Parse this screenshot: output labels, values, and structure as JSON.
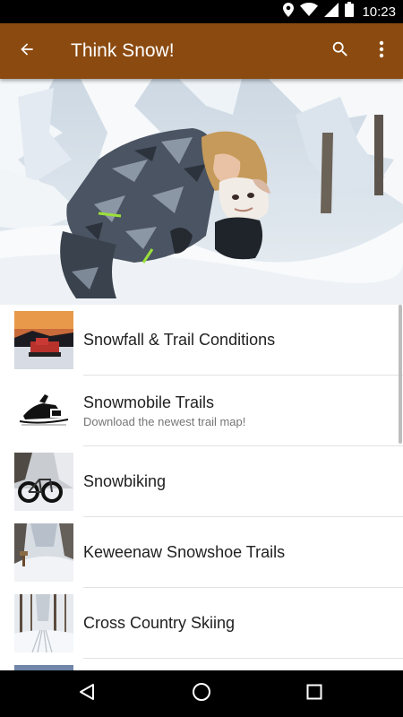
{
  "status_bar": {
    "time": "10:23",
    "icons": [
      "location-icon",
      "wifi-icon",
      "signal-icon",
      "battery-icon"
    ]
  },
  "app_bar": {
    "title": "Think Snow!",
    "back_icon": "arrow-back-icon",
    "search_icon": "search-icon",
    "menu_icon": "more-vert-icon",
    "color": "#8b4a10"
  },
  "hero": {
    "image": "girl-hugging-dog-in-snow"
  },
  "list": {
    "items": [
      {
        "title": "Snowfall & Trail Conditions",
        "subtitle": "",
        "thumb": "groomer-sunset"
      },
      {
        "title": "Snowmobile Trails",
        "subtitle": "Download the newest trail map!",
        "thumb": "snowmobile-logo"
      },
      {
        "title": "Snowbiking",
        "subtitle": "",
        "thumb": "fat-bike-snow"
      },
      {
        "title": "Keweenaw Snowshoe Trails",
        "subtitle": "",
        "thumb": "snowshoe-trail"
      },
      {
        "title": "Cross Country Skiing",
        "subtitle": "",
        "thumb": "ski-tracks-forest"
      }
    ]
  },
  "nav_bar": {
    "back": "nav-back-icon",
    "home": "nav-home-icon",
    "recents": "nav-recents-icon"
  }
}
